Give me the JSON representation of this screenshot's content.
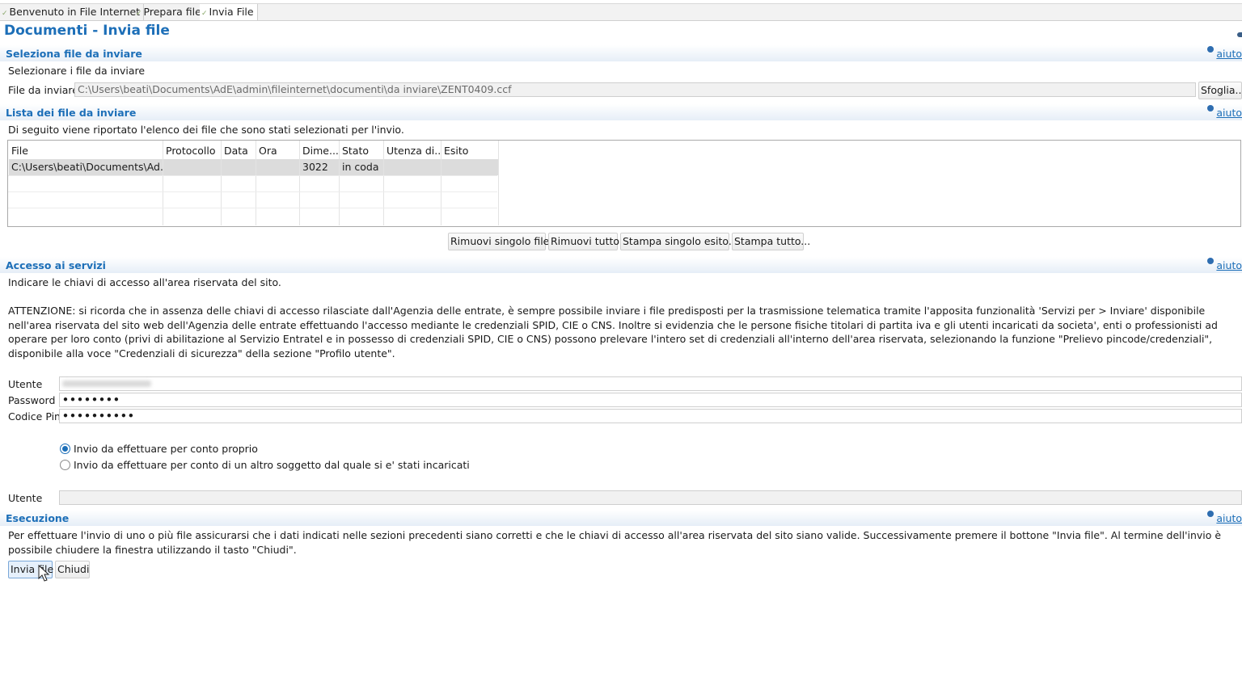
{
  "tabs": [
    {
      "label": "Benvenuto in File Internet"
    },
    {
      "label": "Prepara file"
    },
    {
      "label": "Invia File"
    }
  ],
  "page_title": "Documenti - Invia file",
  "help_label": "aiuto",
  "select_section": {
    "title": "Seleziona file da inviare",
    "instruction": "Selezionare i file da inviare",
    "file_label": "File da inviare",
    "file_value": "C:\\Users\\beati\\Documents\\AdE\\admin\\fileinternet\\documenti\\da inviare\\ZENT0409.ccf",
    "browse_label": "Sfoglia..."
  },
  "list_section": {
    "title": "Lista dei file da inviare",
    "description": "Di seguito viene riportato l'elenco dei file che sono stati selezionati per l'invio.",
    "columns": [
      "File",
      "Protocollo",
      "Data",
      "Ora",
      "Dime...",
      "Stato",
      "Utenza di...",
      "Esito"
    ],
    "rows": [
      {
        "file": "C:\\Users\\beati\\Documents\\Ad...",
        "protocollo": "",
        "data": "",
        "ora": "",
        "dimensione": "3022",
        "stato": "in coda",
        "utenza": "",
        "esito": ""
      }
    ],
    "buttons": {
      "remove_one": "Rimuovi singolo file",
      "remove_all": "Rimuovi tutto",
      "print_one": "Stampa singolo esito...",
      "print_all": "Stampa tutto..."
    }
  },
  "access_section": {
    "title": "Accesso ai servizi",
    "instruction": "Indicare le chiavi di accesso all'area riservata del sito.",
    "warning": "ATTENZIONE: si ricorda che in assenza delle chiavi di accesso rilasciate dall'Agenzia delle entrate, è sempre possibile inviare i file predisposti per la trasmissione telematica tramite l'apposita funzionalità 'Servizi per > Inviare' disponibile nell'area riservata del sito web dell'Agenzia delle entrate effettuando l'accesso mediante le credenziali SPID, CIE o CNS. Inoltre si evidenzia che le persone fisiche titolari di partita iva e gli utenti incaricati da societa', enti o professionisti ad operare per loro conto (privi di abilitazione al Servizio Entratel e in possesso di credenziali SPID, CIE o CNS) possono prelevare l'intero set di credenziali all'interno dell'area riservata, selezionando la funzione \"Prelievo pincode/credenziali\", disponibile alla voce \"Credenziali di sicurezza\" della sezione \"Profilo utente\".",
    "user_label": "Utente",
    "password_label": "Password",
    "password_value": "••••••••",
    "pin_label": "Codice Pin",
    "pin_value": "••••••••••",
    "radio_own": "Invio da effettuare per conto proprio",
    "radio_other": "Invio da effettuare per conto di un altro soggetto dal quale si e' stati incaricati",
    "delegated_user_label": "Utente"
  },
  "exec_section": {
    "title": "Esecuzione",
    "description": "Per effettuare l'invio di uno o più file assicurarsi che i dati indicati nelle sezioni precedenti siano corretti e che le chiavi di accesso all'area riservata del sito siano valide. Successivamente premere il bottone \"Invia file\". Al termine dell'invio è possibile chiudere la finestra utilizzando il tasto \"Chiudi\".",
    "send_label": "Invia file",
    "close_label": "Chiudi"
  }
}
